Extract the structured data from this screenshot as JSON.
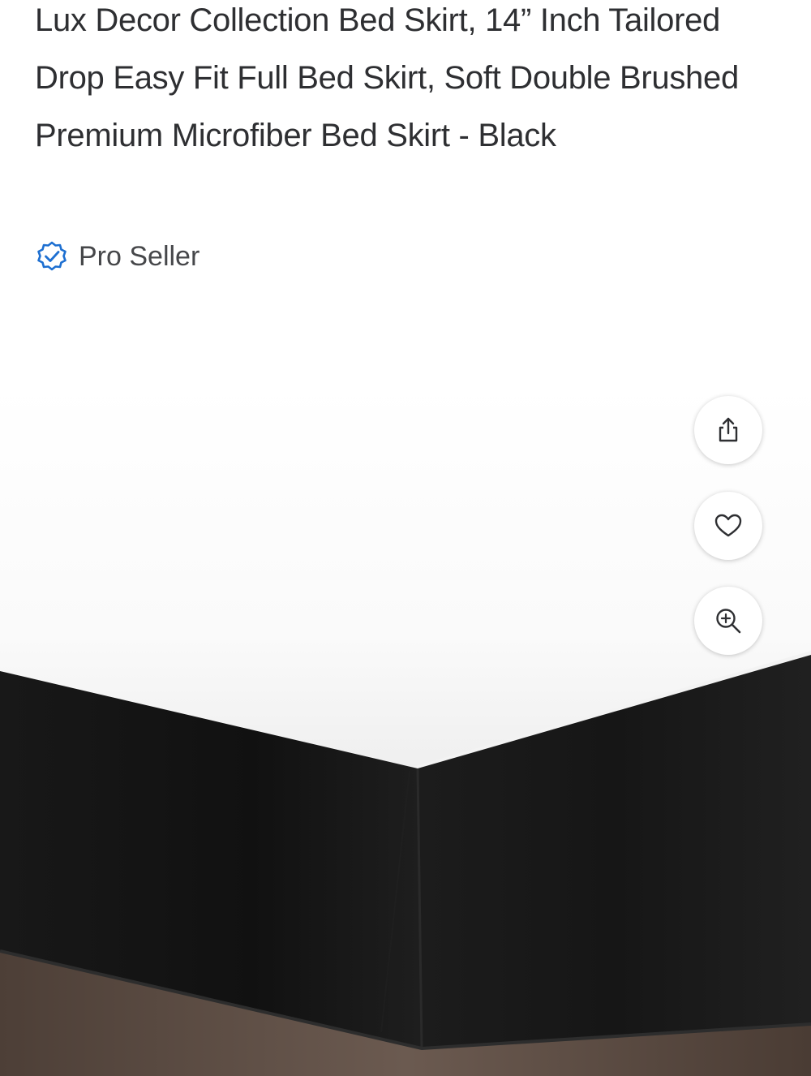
{
  "product": {
    "title": "Lux Decor Collection Bed Skirt, 14” Inch Tailored Drop Easy Fit Full Bed Skirt, Soft Double Brushed Premium Microfiber Bed Skirt - Black",
    "seller_badge": {
      "icon": "verified-check-icon",
      "label": "Pro Seller",
      "icon_color": "#1d6fd1"
    }
  },
  "gallery": {
    "image_alt": "Black bed skirt under white mattress",
    "actions": [
      {
        "icon": "share-icon"
      },
      {
        "icon": "heart-icon"
      },
      {
        "icon": "zoom-in-icon"
      }
    ]
  },
  "colors": {
    "text": "#2e2f32",
    "skirt": "#141414",
    "floor": "#5a4a40"
  }
}
